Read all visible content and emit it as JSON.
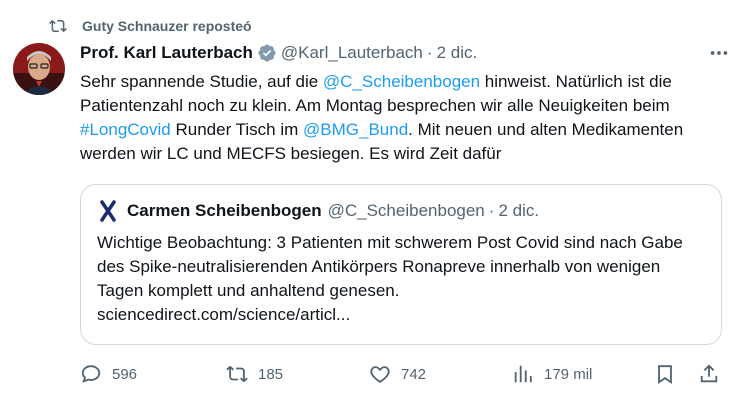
{
  "repost": {
    "icon": "repost-icon",
    "text": "Guty Schnauzer reposteó"
  },
  "tweet": {
    "author_name": "Prof. Karl Lauterbach",
    "handle": "@Karl_Lauterbach",
    "separator": "·",
    "date": "2 dic.",
    "text_parts": {
      "p1": "Sehr spannende Studie, auf die ",
      "mention1": "@C_Scheibenbogen",
      "p2": " hinweist. Natürlich ist die Patientenzahl noch zu klein. Am Montag besprechen wir alle Neuigkeiten beim ",
      "hashtag": "#LongCovid",
      "p3": " Runder Tisch im ",
      "mention2": "@BMG_Bund",
      "p4": ". Mit neuen und alten Medikamenten werden wir LC und MECFS besiegen. Es wird Zeit dafür"
    }
  },
  "quote": {
    "author_name": "Carmen Scheibenbogen",
    "handle": "@C_Scheibenbogen",
    "separator": "·",
    "date": "2 dic.",
    "text": "Wichtige Beobachtung: 3 Patienten mit schwerem Post Covid sind nach Gabe des Spike-neutralisierenden Antikörpers Ronapreve innerhalb von wenigen Tagen komplett und anhaltend genesen.",
    "link": "sciencedirect.com/science/articl..."
  },
  "actions": {
    "replies": "596",
    "reposts": "185",
    "likes": "742",
    "views": "179 mil"
  },
  "colors": {
    "link": "#1d9bf0",
    "muted": "#536471",
    "text": "#0f1419",
    "border": "#cfd9de",
    "verified": "#829aab"
  }
}
